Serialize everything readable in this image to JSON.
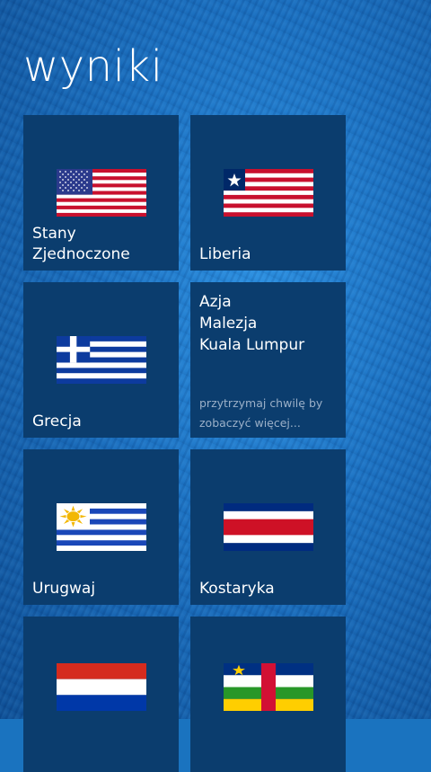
{
  "page": {
    "title": "wyniki"
  },
  "tiles": [
    {
      "label": "Stany Zjednoczone",
      "flag": "flag-usa"
    },
    {
      "label": "Liberia",
      "flag": "flag-liberia"
    },
    {
      "label": "Grecja",
      "flag": "flag-greece"
    },
    {
      "info_lines": [
        "Azja",
        "Malezja",
        "Kuala Lumpur"
      ],
      "hint": "przytrzymaj chwilę by zobaczyć więcej..."
    },
    {
      "label": "Urugwaj",
      "flag": "flag-uruguay"
    },
    {
      "label": "Kostaryka",
      "flag": "flag-costa-rica"
    },
    {
      "label": "",
      "flag": "flag-paraguay"
    },
    {
      "label": "",
      "flag": "flag-central-african-republic"
    }
  ],
  "colors": {
    "background": "#1a73bf",
    "tile": "#0b3d6e",
    "text": "#ffffff",
    "hint": "#9bb0c8"
  }
}
